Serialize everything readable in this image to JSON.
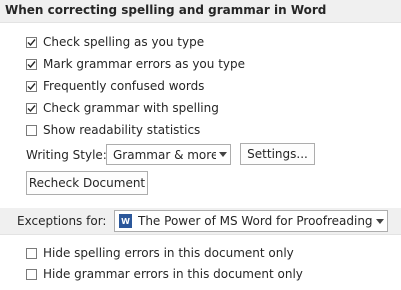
{
  "spelling_section": {
    "title": "When correcting spelling and grammar in Word",
    "options": [
      {
        "label": "Check spelling as you type",
        "checked": true
      },
      {
        "label": "Mark grammar errors as you type",
        "checked": true
      },
      {
        "label": "Frequently confused words",
        "checked": true
      },
      {
        "label": "Check grammar with spelling",
        "checked": true
      },
      {
        "label": "Show readability statistics",
        "checked": false
      }
    ],
    "writing_style_label": "Writing Style:",
    "writing_style_value": "Grammar & more",
    "settings_button": "Settings...",
    "recheck_button": "Recheck Document"
  },
  "exceptions_section": {
    "label": "Exceptions for:",
    "document_value": "The Power of MS Word for Proofreading...",
    "document_icon": "word-document-icon",
    "options": [
      {
        "label": "Hide spelling errors in this document only",
        "checked": false
      },
      {
        "label": "Hide grammar errors in this document only",
        "checked": false
      }
    ]
  },
  "colors": {
    "header_bg": "#f0f0f0",
    "word_blue": "#2b579a"
  }
}
